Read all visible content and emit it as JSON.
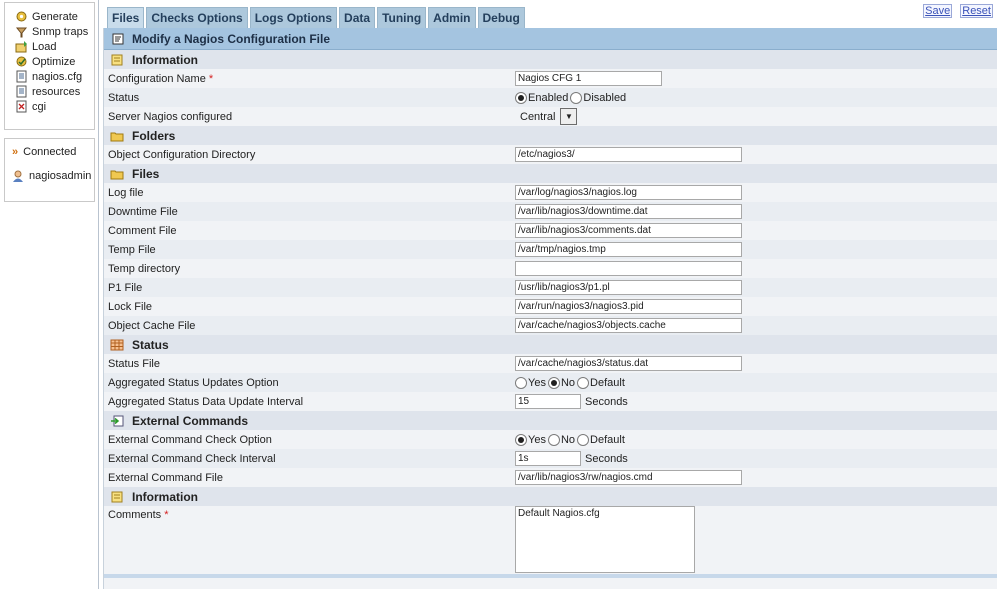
{
  "sidebar": {
    "menu": [
      {
        "label": "Generate",
        "icon": "generate-icon"
      },
      {
        "label": "Snmp traps",
        "icon": "snmp-traps-icon"
      },
      {
        "label": "Load",
        "icon": "load-icon"
      },
      {
        "label": "Optimize",
        "icon": "optimize-icon"
      },
      {
        "label": "nagios.cfg",
        "icon": "file-icon"
      },
      {
        "label": "resources",
        "icon": "file-icon"
      },
      {
        "label": "cgi",
        "icon": "cgi-file-icon"
      }
    ],
    "status": {
      "connected": "Connected",
      "user": "nagiosadmin"
    }
  },
  "tabs": [
    "Files",
    "Checks Options",
    "Logs Options",
    "Data",
    "Tuning",
    "Admin",
    "Debug"
  ],
  "active_tab": "Files",
  "actions": {
    "save": "Save",
    "reset": "Reset"
  },
  "form": {
    "title": "Modify a Nagios Configuration File",
    "sections": {
      "information": "Information",
      "folders": "Folders",
      "files": "Files",
      "status": "Status",
      "external_commands": "External Commands",
      "information2": "Information"
    },
    "labels": {
      "config_name": "Configuration Name",
      "status": "Status",
      "server": "Server Nagios configured",
      "obj_dir": "Object Configuration Directory",
      "log_file": "Log file",
      "downtime_file": "Downtime File",
      "comment_file": "Comment File",
      "temp_file": "Temp File",
      "temp_dir": "Temp directory",
      "p1_file": "P1 File",
      "lock_file": "Lock File",
      "obj_cache_file": "Object Cache File",
      "status_file": "Status File",
      "agg_status_option": "Aggregated Status Updates Option",
      "agg_status_interval": "Aggregated Status Data Update Interval",
      "ext_cmd_option": "External Command Check Option",
      "ext_cmd_interval": "External Command Check Interval",
      "ext_cmd_file": "External Command File",
      "comments": "Comments"
    },
    "required_mark": "*",
    "values": {
      "config_name": "Nagios CFG 1",
      "server": "Central",
      "obj_dir": "/etc/nagios3/",
      "log_file": "/var/log/nagios3/nagios.log",
      "downtime_file": "/var/lib/nagios3/downtime.dat",
      "comment_file": "/var/lib/nagios3/comments.dat",
      "temp_file": "/var/tmp/nagios.tmp",
      "temp_dir": "",
      "p1_file": "/usr/lib/nagios3/p1.pl",
      "lock_file": "/var/run/nagios3/nagios3.pid",
      "obj_cache_file": "/var/cache/nagios3/objects.cache",
      "status_file": "/var/cache/nagios3/status.dat",
      "agg_status_interval": "15",
      "ext_cmd_interval": "1s",
      "ext_cmd_file": "/var/lib/nagios3/rw/nagios.cmd",
      "comments": "Default Nagios.cfg"
    },
    "radio_labels": {
      "enabled": "Enabled",
      "disabled": "Disabled",
      "yes": "Yes",
      "no": "No",
      "default": "Default"
    },
    "status_selected": "Enabled",
    "agg_status_selected": "No",
    "ext_cmd_selected": "Yes",
    "units": {
      "seconds": "Seconds"
    }
  }
}
